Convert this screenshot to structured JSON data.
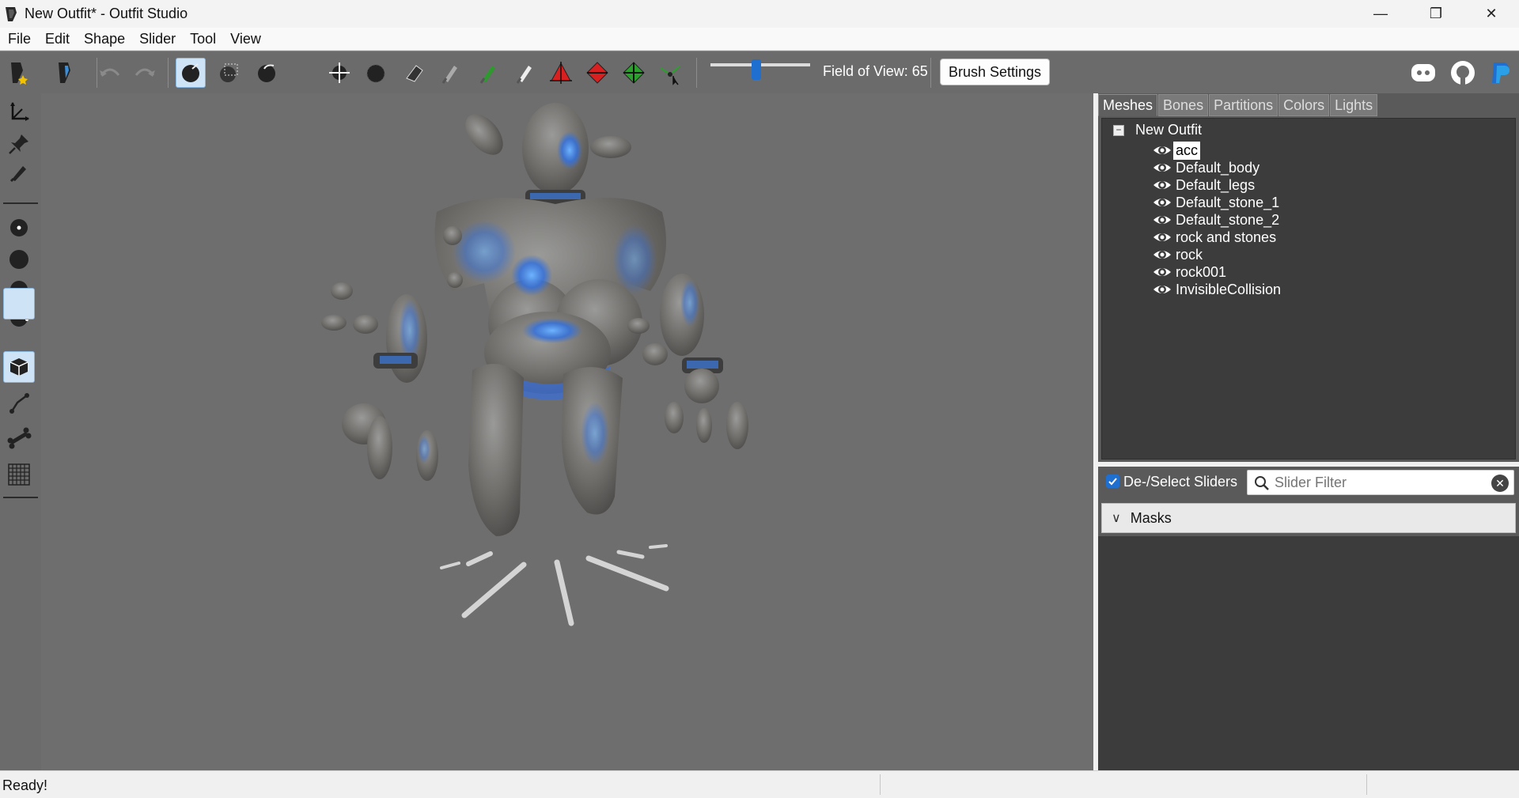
{
  "window": {
    "title": "New Outfit* - Outfit Studio",
    "minimize_glyph": "—",
    "restore_glyph": "❐",
    "close_glyph": "✕"
  },
  "menu": [
    "File",
    "Edit",
    "Shape",
    "Slider",
    "Tool",
    "View"
  ],
  "toolbar": {
    "fov_label": "Field of View: 65",
    "fov_value": 65,
    "brush_settings_label": "Brush Settings",
    "accent_color": "#1f6fd0"
  },
  "right_panel": {
    "tabs": [
      "Meshes",
      "Bones",
      "Partitions",
      "Colors",
      "Lights"
    ],
    "active_tab": "Meshes",
    "tree": {
      "root": "New Outfit",
      "items": [
        "acc",
        "Default_body",
        "Default_legs",
        "Default_stone_1",
        "Default_stone_2",
        "rock and stones",
        "rock",
        "rock001",
        "InvisibleCollision"
      ],
      "selected": "acc"
    },
    "sliders": {
      "deselect_label": "De-/Select Sliders",
      "filter_placeholder": "Slider Filter",
      "masks_label": "Masks"
    }
  },
  "status": {
    "message": "Ready!"
  }
}
